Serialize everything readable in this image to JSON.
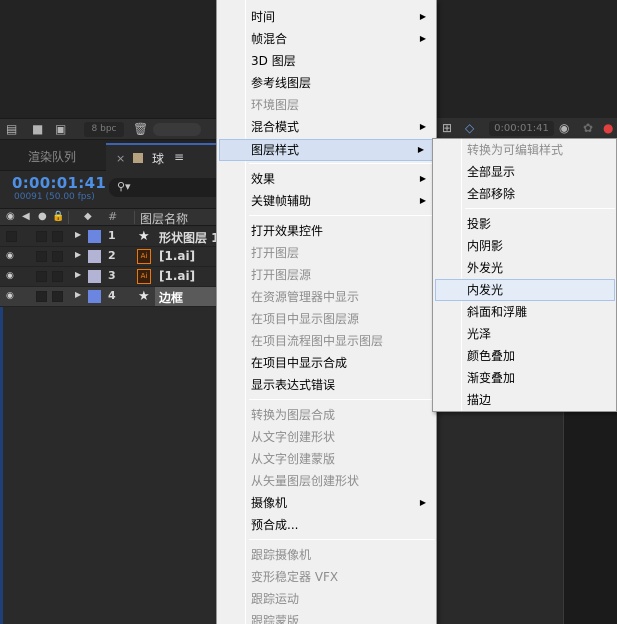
{
  "toolbar": {
    "bpc": "8 bpc"
  },
  "tabs": {
    "render_queue": "渲染队列",
    "close": "×",
    "comp_name": "球",
    "menu": "≡"
  },
  "timeline": {
    "timecode": "0:00:01:41",
    "fps": "00091 (50.00 fps)",
    "header": {
      "num": "#",
      "name": "图层名称"
    },
    "layers": [
      {
        "num": "1",
        "name": "形状图层 1",
        "type": "star",
        "color": "#6b86e0"
      },
      {
        "num": "2",
        "name": "[1.ai]",
        "type": "ai",
        "color": "#b3b3d6"
      },
      {
        "num": "3",
        "name": "[1.ai]",
        "type": "ai",
        "color": "#b3b3d6"
      },
      {
        "num": "4",
        "name": "边框",
        "type": "star",
        "color": "#6b86e0"
      }
    ]
  },
  "viewer": {
    "timecode": "0:00:01:41"
  },
  "context_menu": {
    "items": [
      {
        "label": "时间",
        "submenu": true
      },
      {
        "label": "帧混合",
        "submenu": true
      },
      {
        "label": "3D 图层"
      },
      {
        "label": "参考线图层"
      },
      {
        "label": "环境图层",
        "disabled": true
      },
      {
        "label": "混合模式",
        "submenu": true
      },
      {
        "label": "图层样式",
        "submenu": true,
        "highlighted": true
      },
      {
        "label": "效果",
        "submenu": true
      },
      {
        "label": "关键帧辅助",
        "submenu": true
      },
      {
        "label": "打开效果控件"
      },
      {
        "label": "打开图层",
        "disabled": true
      },
      {
        "label": "打开图层源",
        "disabled": true
      },
      {
        "label": "在资源管理器中显示",
        "disabled": true
      },
      {
        "label": "在项目中显示图层源",
        "disabled": true
      },
      {
        "label": "在项目流程图中显示图层",
        "disabled": true
      },
      {
        "label": "在项目中显示合成"
      },
      {
        "label": "显示表达式错误"
      },
      {
        "label": "转换为图层合成",
        "disabled": true
      },
      {
        "label": "从文字创建形状",
        "disabled": true
      },
      {
        "label": "从文字创建蒙版",
        "disabled": true
      },
      {
        "label": "从矢量图层创建形状",
        "disabled": true
      },
      {
        "label": "摄像机",
        "submenu": true
      },
      {
        "label": "预合成..."
      },
      {
        "label": "跟踪摄像机",
        "disabled": true
      },
      {
        "label": "变形稳定器 VFX",
        "disabled": true
      },
      {
        "label": "跟踪运动",
        "disabled": true
      },
      {
        "label": "跟踪蒙版",
        "disabled": true
      }
    ]
  },
  "layer_style_submenu": {
    "items": [
      {
        "label": "转换为可编辑样式",
        "disabled": true
      },
      {
        "label": "全部显示"
      },
      {
        "label": "全部移除"
      },
      {
        "label": "投影"
      },
      {
        "label": "内阴影"
      },
      {
        "label": "外发光"
      },
      {
        "label": "内发光",
        "highlighted": true
      },
      {
        "label": "斜面和浮雕"
      },
      {
        "label": "光泽"
      },
      {
        "label": "颜色叠加"
      },
      {
        "label": "渐变叠加"
      },
      {
        "label": "描边"
      }
    ]
  }
}
